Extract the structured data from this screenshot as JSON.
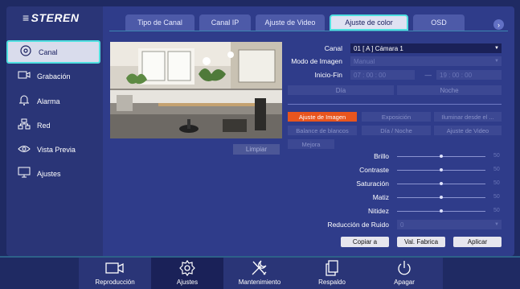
{
  "brand": {
    "logo_text": "STEREN"
  },
  "sidebar": {
    "items": [
      {
        "label": "Canal",
        "icon": "camera-lens-icon",
        "active": true
      },
      {
        "label": "Grabación",
        "icon": "video-record-icon",
        "active": false
      },
      {
        "label": "Alarma",
        "icon": "bell-icon",
        "active": false
      },
      {
        "label": "Red",
        "icon": "network-icon",
        "active": false
      },
      {
        "label": "Vista Previa",
        "icon": "eye-icon",
        "active": false
      },
      {
        "label": "Ajustes",
        "icon": "monitor-icon",
        "active": false
      }
    ]
  },
  "tabs": [
    {
      "label": "Tipo de Canal",
      "active": false
    },
    {
      "label": "Canal IP",
      "active": false
    },
    {
      "label": "Ajuste de Video",
      "active": false
    },
    {
      "label": "Ajuste de color",
      "active": true
    },
    {
      "label": "OSD",
      "active": false
    }
  ],
  "preview": {
    "clear_label": "Limpiar"
  },
  "form": {
    "canal_label": "Canal",
    "canal_value": "01 [ A ] Cámara 1",
    "modo_label": "Modo de Imagen",
    "modo_value": "Manual",
    "inicio_label": "Inicio-Fin",
    "start_time": "07 : 00 : 00",
    "range_sep": "—",
    "end_time": "19 : 00 : 00",
    "dia_label": "Día",
    "noche_label": "Noche"
  },
  "sub_tabs": [
    {
      "label": "Ajuste de Imagen",
      "active": true
    },
    {
      "label": "Exposición",
      "active": false
    },
    {
      "label": "Iluminar desde el ...",
      "active": false
    },
    {
      "label": "Balance de blancos",
      "active": false
    },
    {
      "label": "Día / Noche",
      "active": false
    },
    {
      "label": "Ajuste de Video",
      "active": false
    },
    {
      "label": "Mejora",
      "active": false
    }
  ],
  "sliders": [
    {
      "label": "Brillo",
      "value": "50"
    },
    {
      "label": "Contraste",
      "value": "50"
    },
    {
      "label": "Saturación",
      "value": "50"
    },
    {
      "label": "Matiz",
      "value": "50"
    },
    {
      "label": "Nitidez",
      "value": "50"
    }
  ],
  "noise": {
    "label": "Reducción de Ruido",
    "value": "0"
  },
  "buttons": {
    "copy": "Copiar a",
    "default": "Val. Fabrica",
    "apply": "Aplicar"
  },
  "dock": [
    {
      "label": "Reproducción",
      "icon": "camera-icon",
      "active": false
    },
    {
      "label": "Ajustes",
      "icon": "gear-icon",
      "active": true
    },
    {
      "label": "Mantenimiento",
      "icon": "tools-icon",
      "active": false
    },
    {
      "label": "Respaldo",
      "icon": "files-icon",
      "active": false
    },
    {
      "label": "Apagar",
      "icon": "power-icon",
      "active": false
    }
  ],
  "colors": {
    "accent": "#4fe0e0",
    "active_subtab": "#e8551e",
    "panel": "#2f3c8a"
  }
}
